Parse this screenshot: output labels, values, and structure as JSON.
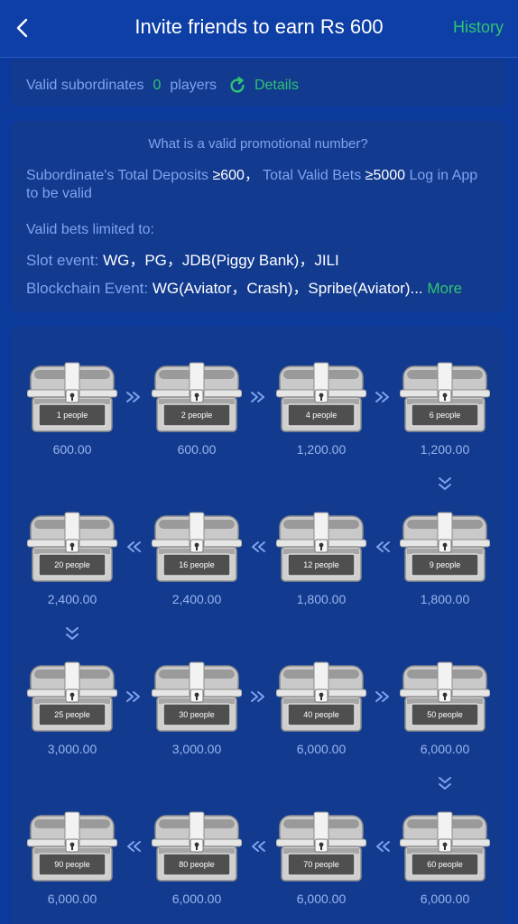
{
  "header": {
    "title": "Invite friends to earn Rs 600",
    "history_label": "History"
  },
  "subordinates": {
    "label": "Valid subordinates",
    "count": "0",
    "unit": "players",
    "details_label": "Details"
  },
  "info": {
    "title": "What is a valid promotional number?",
    "deposit_label": "Subordinate's Total Deposits",
    "deposit_value": "≥600",
    "deposit_sep": "，",
    "bets_label": "Total Valid Bets",
    "bets_value": "≥5000",
    "login_text": "Log in App to be valid",
    "limited_title": "Valid bets limited to:",
    "slot_label": "Slot event:",
    "slot_value": "WG，PG，JDB(Piggy Bank)，JILI",
    "chain_label": "Blockchain Event:",
    "chain_value": "WG(Aviator，Crash)，Spribe(Aviator)...",
    "more_label": "More"
  },
  "rewards": [
    {
      "people": "1 people",
      "amount": "600.00"
    },
    {
      "people": "2 people",
      "amount": "600.00"
    },
    {
      "people": "4 people",
      "amount": "1,200.00"
    },
    {
      "people": "6 people",
      "amount": "1,200.00"
    },
    {
      "people": "9 people",
      "amount": "1,800.00"
    },
    {
      "people": "12 people",
      "amount": "1,800.00"
    },
    {
      "people": "16 people",
      "amount": "2,400.00"
    },
    {
      "people": "20 people",
      "amount": "2,400.00"
    },
    {
      "people": "25 people",
      "amount": "3,000.00"
    },
    {
      "people": "30 people",
      "amount": "3,000.00"
    },
    {
      "people": "40 people",
      "amount": "6,000.00"
    },
    {
      "people": "50 people",
      "amount": "6,000.00"
    },
    {
      "people": "60 people",
      "amount": "6,000.00"
    },
    {
      "people": "70 people",
      "amount": "6,000.00"
    },
    {
      "people": "80 people",
      "amount": "6,000.00"
    },
    {
      "people": "90 people",
      "amount": "6,000.00"
    }
  ],
  "colors": {
    "background": "#0c3a9c",
    "card": "#123a8f",
    "accent_green": "#2fc472",
    "label_blue": "#7fa4ee"
  },
  "icons": {
    "back": "chevron-left-icon",
    "refresh": "refresh-icon",
    "chest": "treasure-chest-icon",
    "arrow_right": "double-chevron-right-icon",
    "arrow_left": "double-chevron-left-icon",
    "arrow_down": "double-chevron-down-icon"
  }
}
